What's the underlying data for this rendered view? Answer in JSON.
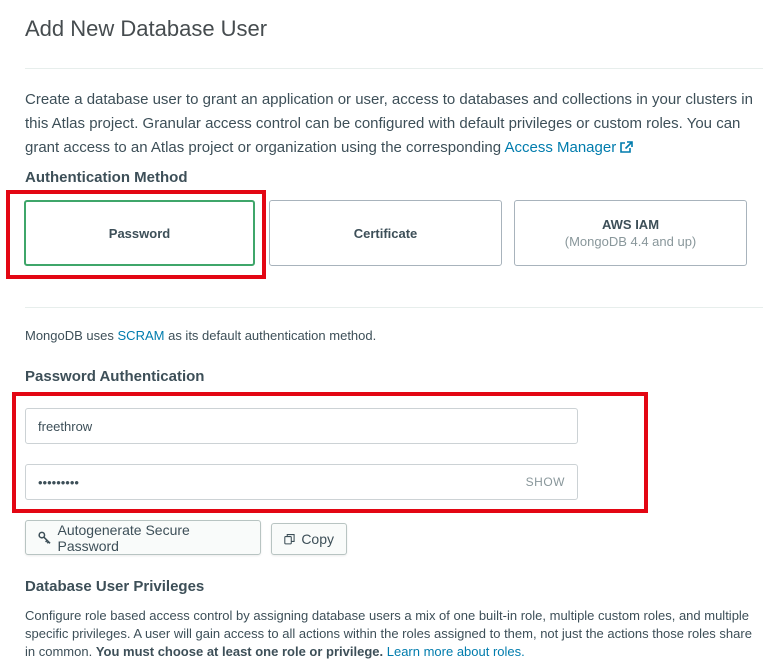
{
  "page": {
    "title": "Add New Database User",
    "intro_text": "Create a database user to grant an application or user, access to databases and collections in your clusters in this Atlas project. Granular access control can be configured with default privileges or custom roles. You can grant access to an Atlas project or organization using the corresponding",
    "intro_link": "Access Manager"
  },
  "auth_method": {
    "heading": "Authentication Method",
    "options": [
      {
        "label": "Password",
        "sublabel": "",
        "selected": true
      },
      {
        "label": "Certificate",
        "sublabel": ""
      },
      {
        "label": "AWS IAM",
        "sublabel": "(MongoDB 4.4 and up)"
      }
    ]
  },
  "scram_note": {
    "prefix": "MongoDB uses",
    "link": "SCRAM",
    "suffix": "as its default authentication method."
  },
  "password_auth": {
    "heading": "Password Authentication",
    "username_value": "freethrow",
    "password_masked": "•••••••••",
    "show_label": "SHOW",
    "autogenerate_label": "Autogenerate Secure Password",
    "copy_label": "Copy"
  },
  "privileges": {
    "heading": "Database User Privileges",
    "text_1": "Configure role based access control by assigning database users a mix of one built-in role, multiple custom roles, and multiple specific privileges. A user will gain access to all actions within the roles assigned to them, not just the actions those roles share in common.",
    "text_bold": "You must choose at least one role or privilege.",
    "link": "Learn more about roles."
  },
  "colors": {
    "selected_border": "#3fa66a",
    "highlight_red": "#e30613",
    "link": "#007cad"
  }
}
